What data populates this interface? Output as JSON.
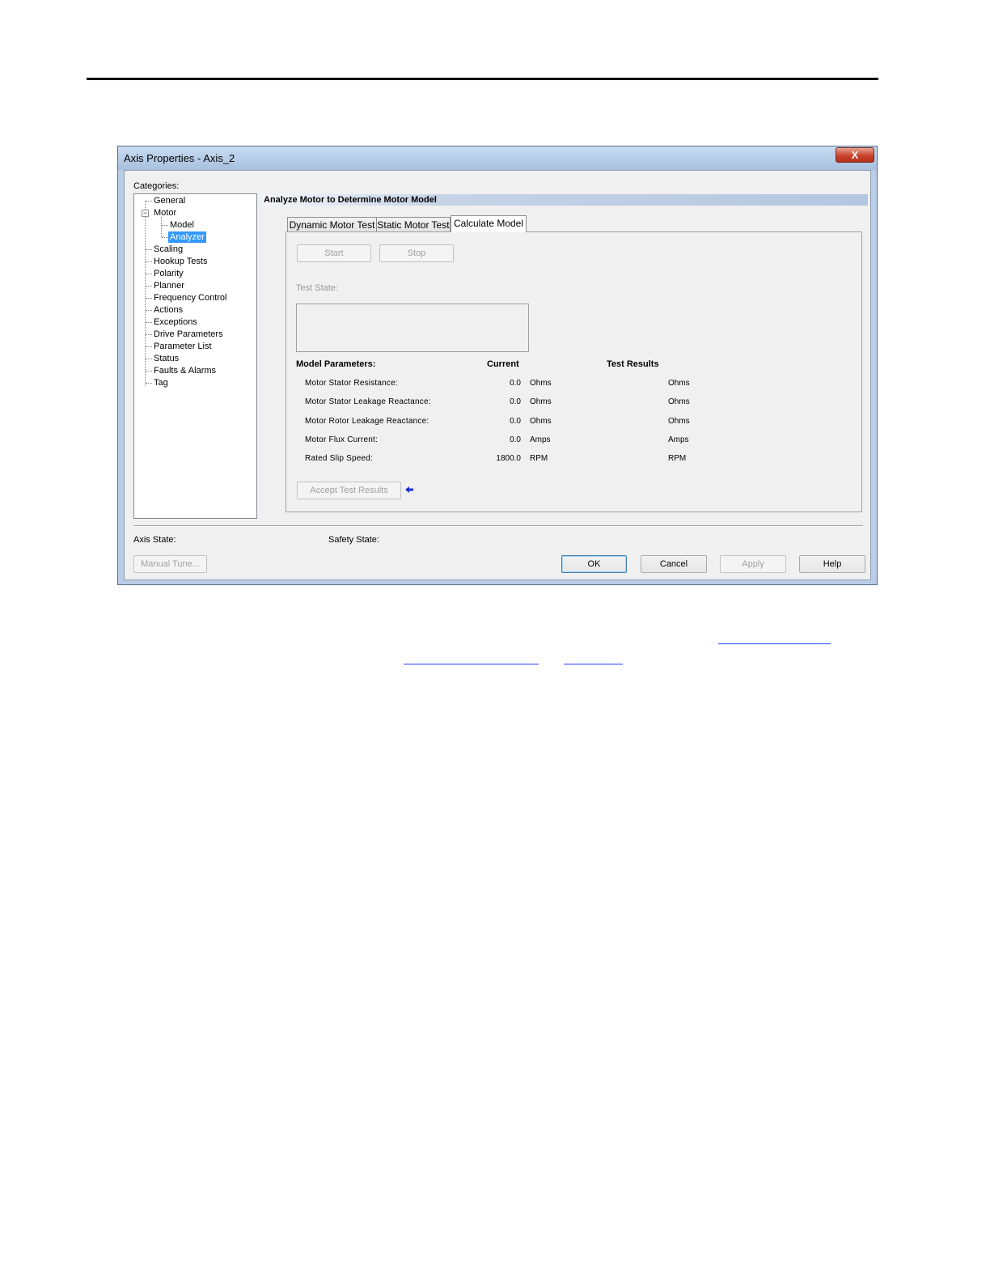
{
  "window": {
    "title": "Axis Properties - Axis_2",
    "close_glyph": "X"
  },
  "categories": {
    "label": "Categories:",
    "items": [
      {
        "label": "General"
      },
      {
        "label": "Motor"
      },
      {
        "label": "Model"
      },
      {
        "label": "Analyzer"
      },
      {
        "label": "Scaling"
      },
      {
        "label": "Hookup Tests"
      },
      {
        "label": "Polarity"
      },
      {
        "label": "Planner"
      },
      {
        "label": "Frequency Control"
      },
      {
        "label": "Actions"
      },
      {
        "label": "Exceptions"
      },
      {
        "label": "Drive Parameters"
      },
      {
        "label": "Parameter List"
      },
      {
        "label": "Status"
      },
      {
        "label": "Faults & Alarms"
      },
      {
        "label": "Tag"
      }
    ],
    "selected": "Analyzer"
  },
  "section": {
    "title": "Analyze Motor to Determine Motor Model"
  },
  "tabs": [
    {
      "label": "Dynamic Motor Test"
    },
    {
      "label": "Static Motor Test"
    },
    {
      "label": "Calculate Model"
    }
  ],
  "active_tab": "Calculate Model",
  "controls": {
    "start_label": "Start",
    "stop_label": "Stop",
    "test_state_label": "Test State:",
    "accept_label": "Accept Test Results"
  },
  "model": {
    "header_params": "Model Parameters:",
    "header_current": "Current",
    "header_results": "Test Results",
    "rows": [
      {
        "label": "Motor Stator Resistance:",
        "current": "0.0",
        "unit": "Ohms",
        "result_unit": "Ohms"
      },
      {
        "label": "Motor Stator Leakage Reactance:",
        "current": "0.0",
        "unit": "Ohms",
        "result_unit": "Ohms"
      },
      {
        "label": "Motor Rotor Leakage Reactance:",
        "current": "0.0",
        "unit": "Ohms",
        "result_unit": "Ohms"
      },
      {
        "label": "Motor Flux Current:",
        "current": "0.0",
        "unit": "Amps",
        "result_unit": "Amps"
      },
      {
        "label": "Rated Slip Speed:",
        "current": "1800.0",
        "unit": "RPM",
        "result_unit": "RPM"
      }
    ]
  },
  "footer": {
    "axis_state_label": "Axis State:",
    "safety_state_label": "Safety State:",
    "manual_tune_label": "Manual Tune...",
    "ok_label": "OK",
    "cancel_label": "Cancel",
    "apply_label": "Apply",
    "help_label": "Help"
  },
  "colors": {
    "selection": "#3399ff",
    "link": "#1f3fff",
    "close_button": "#c9432c"
  }
}
